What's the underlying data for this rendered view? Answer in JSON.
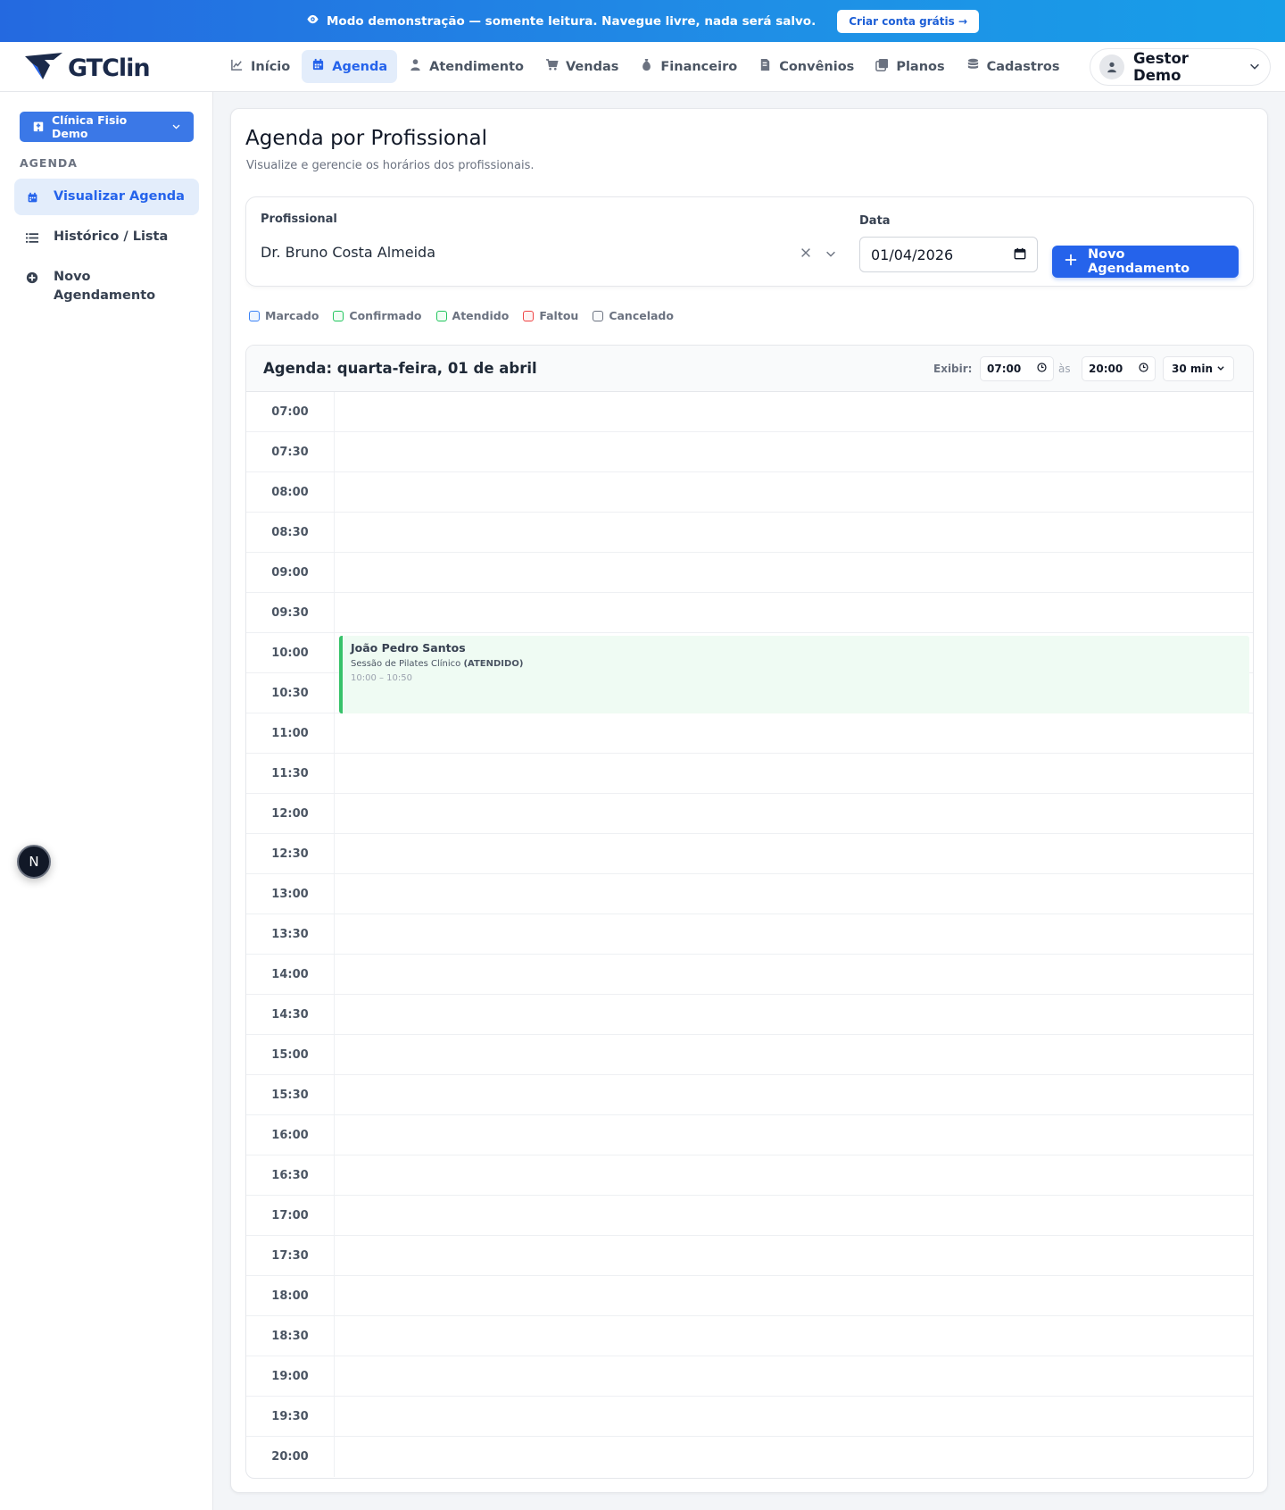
{
  "banner": {
    "message": "Modo demonstração — somente leitura. Navegue livre, nada será salvo.",
    "cta": "Criar conta grátis →"
  },
  "brand": {
    "name": "GTClin"
  },
  "nav": {
    "items": [
      {
        "label": "Início",
        "icon": "chart-line-icon"
      },
      {
        "label": "Agenda",
        "icon": "calendar-icon",
        "active": true
      },
      {
        "label": "Atendimento",
        "icon": "user-doctor-icon"
      },
      {
        "label": "Vendas",
        "icon": "cart-icon"
      },
      {
        "label": "Financeiro",
        "icon": "money-bag-icon"
      },
      {
        "label": "Convênios",
        "icon": "file-invoice-icon"
      },
      {
        "label": "Planos",
        "icon": "plans-icon"
      },
      {
        "label": "Cadastros",
        "icon": "database-icon"
      }
    ],
    "user": "Gestor Demo"
  },
  "sidebar": {
    "clinic": "Clínica Fisio Demo",
    "section": "AGENDA",
    "items": [
      {
        "label": "Visualizar Agenda",
        "icon": "calendar-icon",
        "active": true
      },
      {
        "label": "Histórico / Lista",
        "icon": "list-icon"
      },
      {
        "label": "Novo Agendamento",
        "icon": "plus-circle-icon"
      }
    ],
    "badge": "N"
  },
  "page": {
    "title": "Agenda por Profissional",
    "subtitle": "Visualize e gerencie os horários dos profissionais."
  },
  "filters": {
    "professional_label": "Profissional",
    "professional_value": "Dr. Bruno Costa Almeida",
    "date_label": "Data",
    "date_value": "01/04/2026",
    "new_button": "Novo Agendamento"
  },
  "legend": [
    {
      "label": "Marcado",
      "color": "#3b82f6"
    },
    {
      "label": "Confirmado",
      "color": "#22c55e"
    },
    {
      "label": "Atendido",
      "color": "#22c55e"
    },
    {
      "label": "Faltou",
      "color": "#ef4444"
    },
    {
      "label": "Cancelado",
      "color": "#6b7280"
    }
  ],
  "agenda": {
    "title": "Agenda: quarta-feira, 01 de abril",
    "show_label": "Exibir:",
    "from": "07:00",
    "to_label": "às",
    "to": "20:00",
    "interval": "30 min",
    "slots": [
      "07:00",
      "07:30",
      "08:00",
      "08:30",
      "09:00",
      "09:30",
      "10:00",
      "10:30",
      "11:00",
      "11:30",
      "12:00",
      "12:30",
      "13:00",
      "13:30",
      "14:00",
      "14:30",
      "15:00",
      "15:30",
      "16:00",
      "16:30",
      "17:00",
      "17:30",
      "18:00",
      "18:30",
      "19:00",
      "19:30",
      "20:00"
    ],
    "event": {
      "patient": "João Pedro Santos",
      "service": "Sessão de Pilates Clínico",
      "status": "(ATENDIDO)",
      "time": "10:00 – 10:50",
      "color": "#37c26a"
    }
  }
}
